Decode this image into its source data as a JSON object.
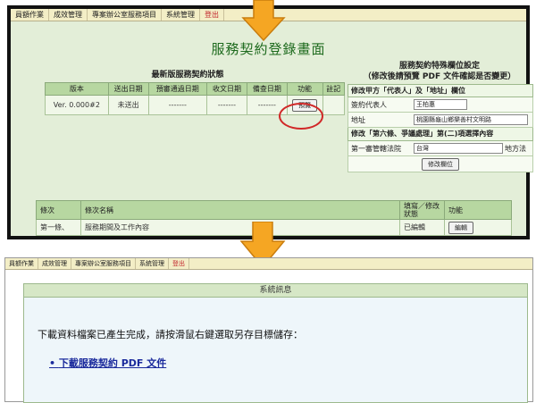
{
  "menu": [
    "員額作業",
    "成效管理",
    "專案辦公室服務項目",
    "系統管理",
    "登出"
  ],
  "top": {
    "title": "服務契約登錄畫面",
    "left_subtitle": "最新版服務契約狀態",
    "right_subtitle_line1": "服務契約特殊欄位設定",
    "right_subtitle_line2": "（修改後請預覽 PDF 文件確認是否變更）",
    "contract_table": {
      "headers": [
        "版本",
        "送出日期",
        "預審通過日期",
        "收文日期",
        "備查日期",
        "功能",
        "註記"
      ],
      "row": [
        "Ver. 0.000#2",
        "未送出",
        "-------",
        "-------",
        "-------",
        "預覽",
        ""
      ]
    },
    "special_fields": {
      "section1": "修改甲方「代表人」及「地址」欄位",
      "rep_label": "簽約代表人",
      "rep_value": "王柏惠",
      "addr_label": "地址",
      "addr_value": "桃園縣龜山鄉樂善村文明路",
      "section2": "修改「第六條、爭議處理」第(二)項選擇內容",
      "court_label": "第一審管轄法院",
      "court_value": "台灣",
      "court_suffix": "地方法",
      "modify_button": "修改欄位"
    },
    "clause_table": {
      "headers": [
        "條次",
        "條次名稱",
        "填寫／修改狀態",
        "功能"
      ],
      "row": [
        "第一條、",
        "服務期間及工作內容",
        "已編輯",
        "編輯"
      ]
    }
  },
  "bottom": {
    "system_title": "系統訊息",
    "message": "下載資料檔案已產生完成，請按滑鼠右鍵選取另存目標儲存：",
    "download_link": "下載服務契約 PDF 文件"
  },
  "colors": {
    "arrow": "#f5a623",
    "highlight_circle": "#d12828",
    "title_green": "#1d6a1d"
  }
}
